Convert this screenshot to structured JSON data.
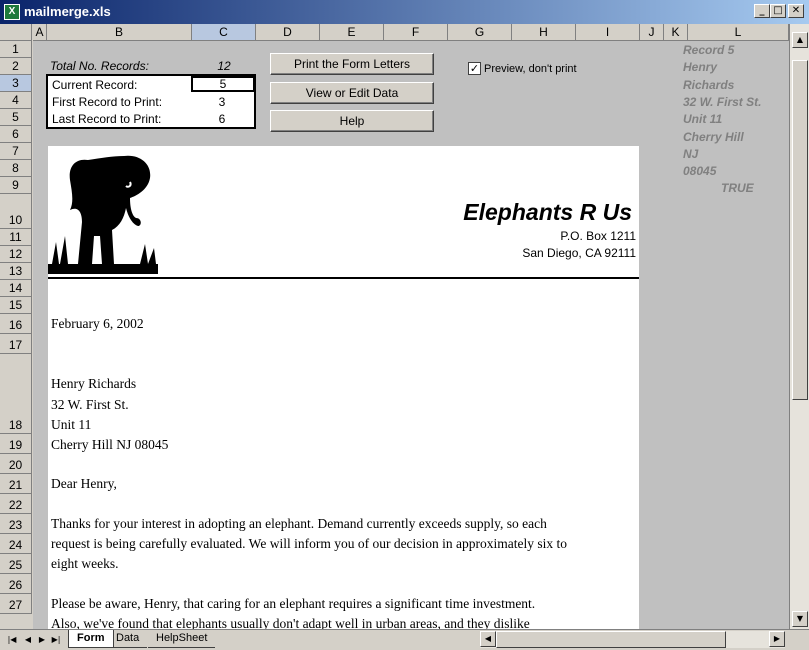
{
  "window": {
    "title": "mailmerge.xls",
    "app_icon_glyph": "X"
  },
  "columns": [
    "A",
    "B",
    "C",
    "D",
    "E",
    "F",
    "G",
    "H",
    "I",
    "J",
    "K",
    "L"
  ],
  "active_column": "C",
  "rows": [
    "1",
    "2",
    "3",
    "4",
    "5",
    "6",
    "7",
    "8",
    "9",
    "10",
    "11",
    "12",
    "13",
    "14",
    "15",
    "16",
    "17",
    "18",
    "19",
    "20",
    "21",
    "22",
    "23",
    "24",
    "25",
    "26",
    "27"
  ],
  "active_row": "3",
  "controls": {
    "total_label": "Total No. Records:",
    "total_value": "12",
    "current_label": "Current Record:",
    "current_value": "5",
    "first_label": "First Record to Print:",
    "first_value": "3",
    "last_label": "Last Record to Print:",
    "last_value": "6",
    "print_button": "Print the Form Letters",
    "view_button": "View or Edit Data",
    "help_button": "Help",
    "preview_label": "Preview, don't print",
    "preview_checked": "✓"
  },
  "record": {
    "record_label": "Record 5",
    "first_name": "Henry",
    "last_name": "Richards",
    "street": "32 W. First St.",
    "unit": "Unit 11",
    "city": "Cherry Hill",
    "state": "NJ",
    "zip": "08045",
    "flag": "TRUE"
  },
  "letter": {
    "company": "Elephants R Us",
    "po_box": "P.O. Box 1211",
    "city_line": "San Diego, CA 92111",
    "date": "February 6, 2002",
    "addr_name": "Henry Richards",
    "addr_street": "32 W. First St.",
    "addr_unit": "Unit 11",
    "addr_city": "Cherry Hill NJ 08045",
    "greeting": "Dear Henry,",
    "p1_l1": "Thanks for your interest in adopting an elephant. Demand currently exceeds supply, so each",
    "p1_l2": "request is being carefully evaluated. We will inform you of our decision in approximately six to",
    "p1_l3": "eight weeks.",
    "p2_l1": "Please be aware, Henry, that caring for an elephant requires a significant time investment.",
    "p2_l2": "Also, we've found that elephants usually don't adapt well in urban areas, and they dislike"
  },
  "sheet_tabs": [
    "Form",
    "Data",
    "HelpSheet"
  ],
  "active_tab": "Form",
  "colors": {
    "title_bar": "#0a246a",
    "selected_header": "#b8c8e0",
    "side_text": "#808080"
  }
}
